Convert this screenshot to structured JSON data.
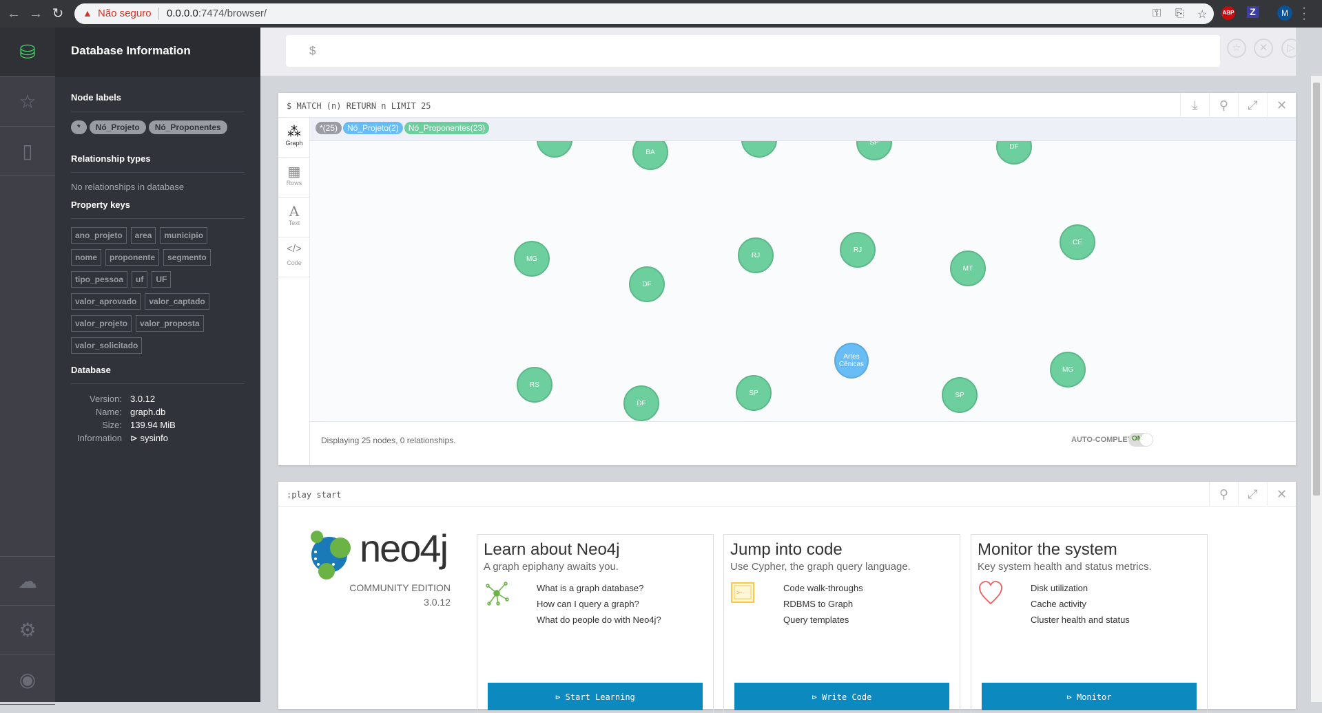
{
  "browser": {
    "security_label": "Não seguro",
    "url_host": "0.0.0.0",
    "url_rest": ":7474/browser/",
    "avatar_letter": "M",
    "abp": "ABP",
    "ext_z": "Z"
  },
  "sidebar": {
    "rail_icons": [
      "database-icon",
      "star-icon",
      "book-icon",
      "cloud-icon",
      "gear-icon",
      "about-icon"
    ]
  },
  "drawer": {
    "title": "Database Information",
    "node_labels_heading": "Node labels",
    "node_labels": [
      "*",
      "Nó_Projeto",
      "Nó_Proponentes"
    ],
    "relationship_heading": "Relationship types",
    "relationship_empty": "No relationships in database",
    "property_heading": "Property keys",
    "property_keys": [
      "ano_projeto",
      "area",
      "municipio",
      "nome",
      "proponente",
      "segmento",
      "tipo_pessoa",
      "uf",
      "UF",
      "valor_aprovado",
      "valor_captado",
      "valor_projeto",
      "valor_proposta",
      "valor_solicitado"
    ],
    "database_heading": "Database",
    "db": {
      "version_label": "Version:",
      "version": "3.0.12",
      "name_label": "Name:",
      "name": "graph.db",
      "size_label": "Size:",
      "size": "139.94 MiB",
      "info_label": "Information",
      "info": "sysinfo"
    }
  },
  "editor": {
    "prompt": "$"
  },
  "result": {
    "query": "$ MATCH (n) RETURN n LIMIT 25",
    "tabs": [
      "Graph",
      "Rows",
      "Text",
      "Code"
    ],
    "legend": [
      {
        "label": "*(25)",
        "color": "#9a9ca3"
      },
      {
        "label": "Nó_Projeto(2)",
        "color": "#68bdf6"
      },
      {
        "label": "Nó_Proponentes(23)",
        "color": "#6dce9e"
      }
    ],
    "nodes": [
      {
        "label": "",
        "type": "proponente"
      },
      {
        "label": "BA",
        "type": "proponente"
      },
      {
        "label": "",
        "type": "proponente"
      },
      {
        "label": "SP",
        "type": "proponente"
      },
      {
        "label": "DF",
        "type": "proponente"
      },
      {
        "label": "MG",
        "type": "proponente"
      },
      {
        "label": "DF",
        "type": "proponente"
      },
      {
        "label": "RJ",
        "type": "proponente"
      },
      {
        "label": "RJ",
        "type": "proponente"
      },
      {
        "label": "MT",
        "type": "proponente"
      },
      {
        "label": "CE",
        "type": "proponente"
      },
      {
        "label": "Artes Cênicas",
        "type": "projeto"
      },
      {
        "label": "RS",
        "type": "proponente"
      },
      {
        "label": "DF",
        "type": "proponente"
      },
      {
        "label": "SP",
        "type": "proponente"
      },
      {
        "label": "SP",
        "type": "proponente"
      },
      {
        "label": "MG",
        "type": "proponente"
      }
    ],
    "status": "Displaying 25 nodes, 0 relationships.",
    "autocomplete_label": "AUTO-COMPLETE",
    "autocomplete_state": "ON"
  },
  "play": {
    "command": ":play start",
    "edition": "COMMUNITY EDITION",
    "version": "3.0.12",
    "logo_text": "neo4j",
    "cards": [
      {
        "title": "Learn about Neo4j",
        "subtitle": "A graph epiphany awaits you.",
        "links": [
          "What is a graph database?",
          "How can I query a graph?",
          "What do people do with Neo4j?"
        ],
        "button": "Start Learning"
      },
      {
        "title": "Jump into code",
        "subtitle": "Use Cypher, the graph query language.",
        "links": [
          "Code walk-throughs",
          "RDBMS to Graph",
          "Query templates"
        ],
        "button": "Write Code"
      },
      {
        "title": "Monitor the system",
        "subtitle": "Key system health and status metrics.",
        "links": [
          "Disk utilization",
          "Cache activity",
          "Cluster health and status"
        ],
        "button": "Monitor"
      }
    ]
  }
}
